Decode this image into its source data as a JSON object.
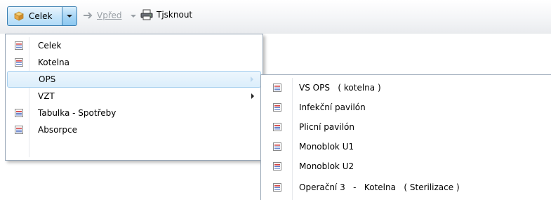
{
  "toolbar": {
    "split_button": {
      "label": "Celek",
      "icon": "folder-cube-icon"
    },
    "forward_button": {
      "label": "Vpřed"
    },
    "print_button": {
      "label": "Tjsknout",
      "icon": "printer-icon"
    }
  },
  "menu": {
    "items": [
      {
        "label": "Celek",
        "icon": "report-icon"
      },
      {
        "label": "Kotelna",
        "icon": "report-icon"
      },
      {
        "label": "OPS",
        "submenu": true,
        "highlighted": true
      },
      {
        "label": "VZT",
        "submenu": true
      },
      {
        "label": "Tabulka - Spotřeby",
        "icon": "report-icon"
      },
      {
        "label": "Absorpce",
        "icon": "report-icon"
      }
    ]
  },
  "submenu": {
    "parent": "OPS",
    "items": [
      {
        "label": "VS OPS   ( kotelna )",
        "icon": "report-icon"
      },
      {
        "label": "Infekční pavilón",
        "icon": "report-icon"
      },
      {
        "label": "Plicní pavilón",
        "icon": "report-icon"
      },
      {
        "label": "Monoblok U1",
        "icon": "report-icon"
      },
      {
        "label": "Monoblok U2",
        "icon": "report-icon"
      },
      {
        "label": "Operační 3   -   Kotelna   ( Sterilizace )",
        "icon": "report-icon"
      }
    ]
  },
  "colors": {
    "highlight": "#dbeefb",
    "accent": "#3c7fb1",
    "disabled_text": "#9aa0a6"
  }
}
